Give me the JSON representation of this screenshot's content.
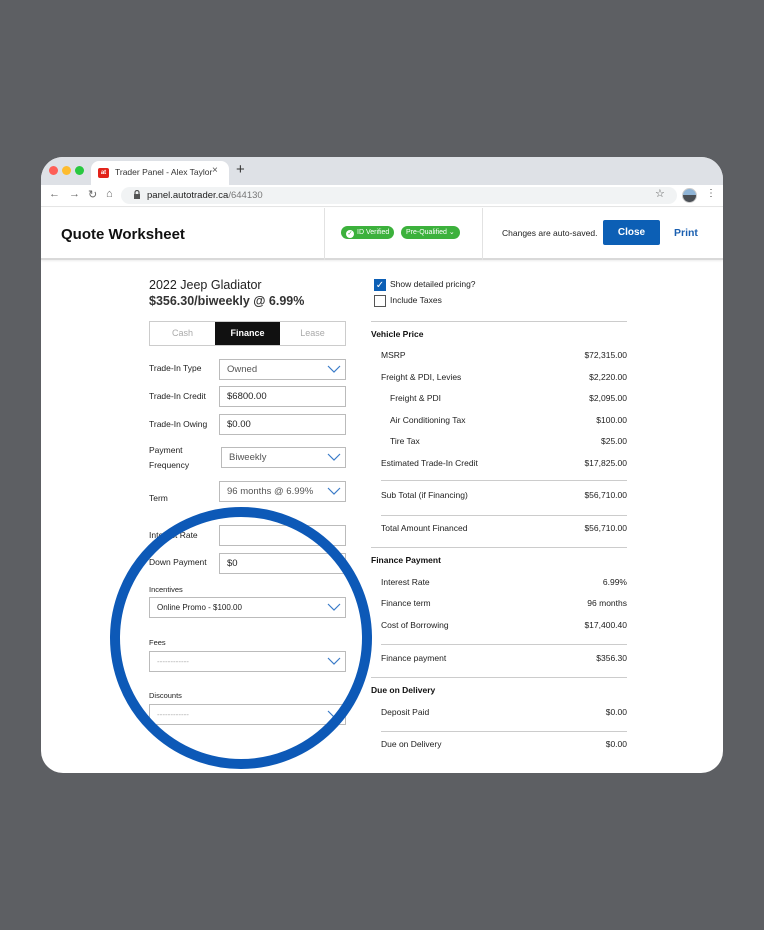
{
  "browser": {
    "tab_title": "Trader Panel - Alex Taylor",
    "tab_close": "×",
    "new_tab": "+",
    "favicon_text": "at",
    "url_domain": "panel.autotrader.ca",
    "url_path": "/644130",
    "back": "←",
    "forward": "→",
    "reload": "↻",
    "home": "⌂",
    "star": "☆",
    "menu": "⋮"
  },
  "header": {
    "title": "Quote Worksheet",
    "badges": [
      "ID Verified",
      "Pre-Qualified"
    ],
    "autosaved": "Changes are auto-saved.",
    "close_label": "Close",
    "print_label": "Print"
  },
  "vehicle": {
    "title": "2022 Jeep Gladiator",
    "price_line": "$356.30/biweekly @ 6.99%"
  },
  "tabs": [
    "Cash",
    "Finance",
    "Lease"
  ],
  "active_tab": "Finance",
  "form": {
    "trade_in_type": {
      "label": "Trade-In Type",
      "value": "Owned"
    },
    "trade_in_credit": {
      "label": "Trade-In Credit",
      "value": "$6800.00"
    },
    "trade_in_owing": {
      "label": "Trade-In Owing",
      "value": "$0.00"
    },
    "payment_frequency": {
      "label_line1": "Payment",
      "label_line2": "Frequency",
      "value": "Biweekly"
    },
    "term": {
      "label": "Term",
      "value": "96 months @ 6.99%"
    },
    "interest_rate": {
      "label": "Interest Rate",
      "value": ""
    },
    "down_payment": {
      "label": "Down Payment",
      "value": "$0"
    },
    "incentives": {
      "label": "Incentives",
      "value": "Online Promo - $100.00"
    },
    "fees": {
      "label": "Fees",
      "value": "------------"
    },
    "discounts": {
      "label": "Discounts",
      "value": "------------"
    }
  },
  "summary": {
    "show_detailed": {
      "label": "Show detailed pricing?",
      "checked": true
    },
    "include_taxes": {
      "label": "Include Taxes",
      "checked": false
    },
    "vehicle_price": {
      "heading": "Vehicle Price",
      "msrp": {
        "label": "MSRP",
        "value": "$72,315.00"
      },
      "freight_levies": {
        "label": "Freight & PDI, Levies",
        "value": "$2,220.00"
      },
      "freight_pdi": {
        "label": "Freight & PDI",
        "value": "$2,095.00"
      },
      "ac_tax": {
        "label": "Air Conditioning Tax",
        "value": "$100.00"
      },
      "tire_tax": {
        "label": "Tire Tax",
        "value": "$25.00"
      },
      "trade_in_credit": {
        "label": "Estimated Trade-In Credit",
        "value": "$17,825.00"
      },
      "subtotal": {
        "label": "Sub Total (if Financing)",
        "value": "$56,710.00"
      },
      "total_financed": {
        "label": "Total Amount Financed",
        "value": "$56,710.00"
      }
    },
    "finance_payment": {
      "heading": "Finance Payment",
      "interest_rate": {
        "label": "Interest Rate",
        "value": "6.99%"
      },
      "term": {
        "label": "Finance term",
        "value": "96 months"
      },
      "cost_of_borrowing": {
        "label": "Cost of Borrowing",
        "value": "$17,400.40"
      },
      "payment": {
        "label": "Finance payment",
        "value": "$356.30"
      }
    },
    "due_on_delivery": {
      "heading": "Due on Delivery",
      "deposit": {
        "label": "Deposit Paid",
        "value": "$0.00"
      },
      "due": {
        "label": "Due on Delivery",
        "value": "$0.00"
      }
    }
  },
  "colors": {
    "brand_blue": "#0c5fb5",
    "badge_green": "#3cb13c",
    "highlight_ring": "#0d59b7",
    "backdrop": "#5d5f63"
  }
}
